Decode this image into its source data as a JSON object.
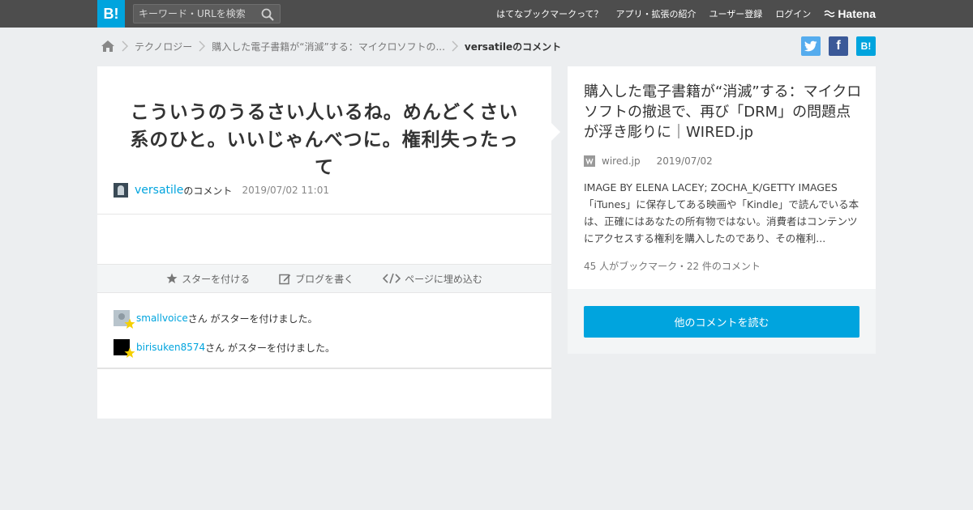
{
  "header": {
    "logo": "B!",
    "search_placeholder": "キーワード・URLを検索",
    "nav": [
      "はてなブックマークって？",
      "アプリ・拡張の紹介",
      "ユーザー登録",
      "ログイン"
    ],
    "brand": "Hatena"
  },
  "breadcrumb": {
    "items": [
      "テクノロジー",
      "購入した電子書籍が“消滅”する：マイクロソフトの..."
    ],
    "current": "versatileのコメント"
  },
  "share": {
    "facebook": "f",
    "hatena": "B!"
  },
  "comment": {
    "text": "こういうのうるさい人いるね。めんどくさい系のひと。いいじゃんべつに。権利失ったって",
    "user": "versatile",
    "suffix": "のコメント",
    "datetime": "2019/07/02 11:01"
  },
  "actions": {
    "star": "スターを付ける",
    "blog": "ブログを書く",
    "embed": "ページに埋め込む"
  },
  "stars": [
    {
      "user": "smallvoice",
      "text": "さん がスターを付けました。"
    },
    {
      "user": "birisuken8574",
      "text": "さん がスターを付けました。"
    }
  ],
  "entry": {
    "title": "購入した電子書籍が“消滅”する：マイクロソフトの撤退で、再び「DRM」の問題点が浮き彫りに｜WIRED.jp",
    "source": "wired.jp",
    "date": "2019/07/02",
    "summary": "IMAGE BY ELENA LACEY; ZOCHA_K/GETTY IMAGES 「iTunes」に保存してある映画や「Kindle」で読んでいる本は、正確にはあなたの所有物ではない。消費者はコンテンツにアクセスする権利を購入したのであり、その権利...",
    "count": "45 人がブックマーク・22 件のコメント",
    "read_more": "他のコメントを読む"
  },
  "colors": {
    "accent": "#00a4de",
    "topbar": "#4d4d4d",
    "background": "#eceef0"
  }
}
